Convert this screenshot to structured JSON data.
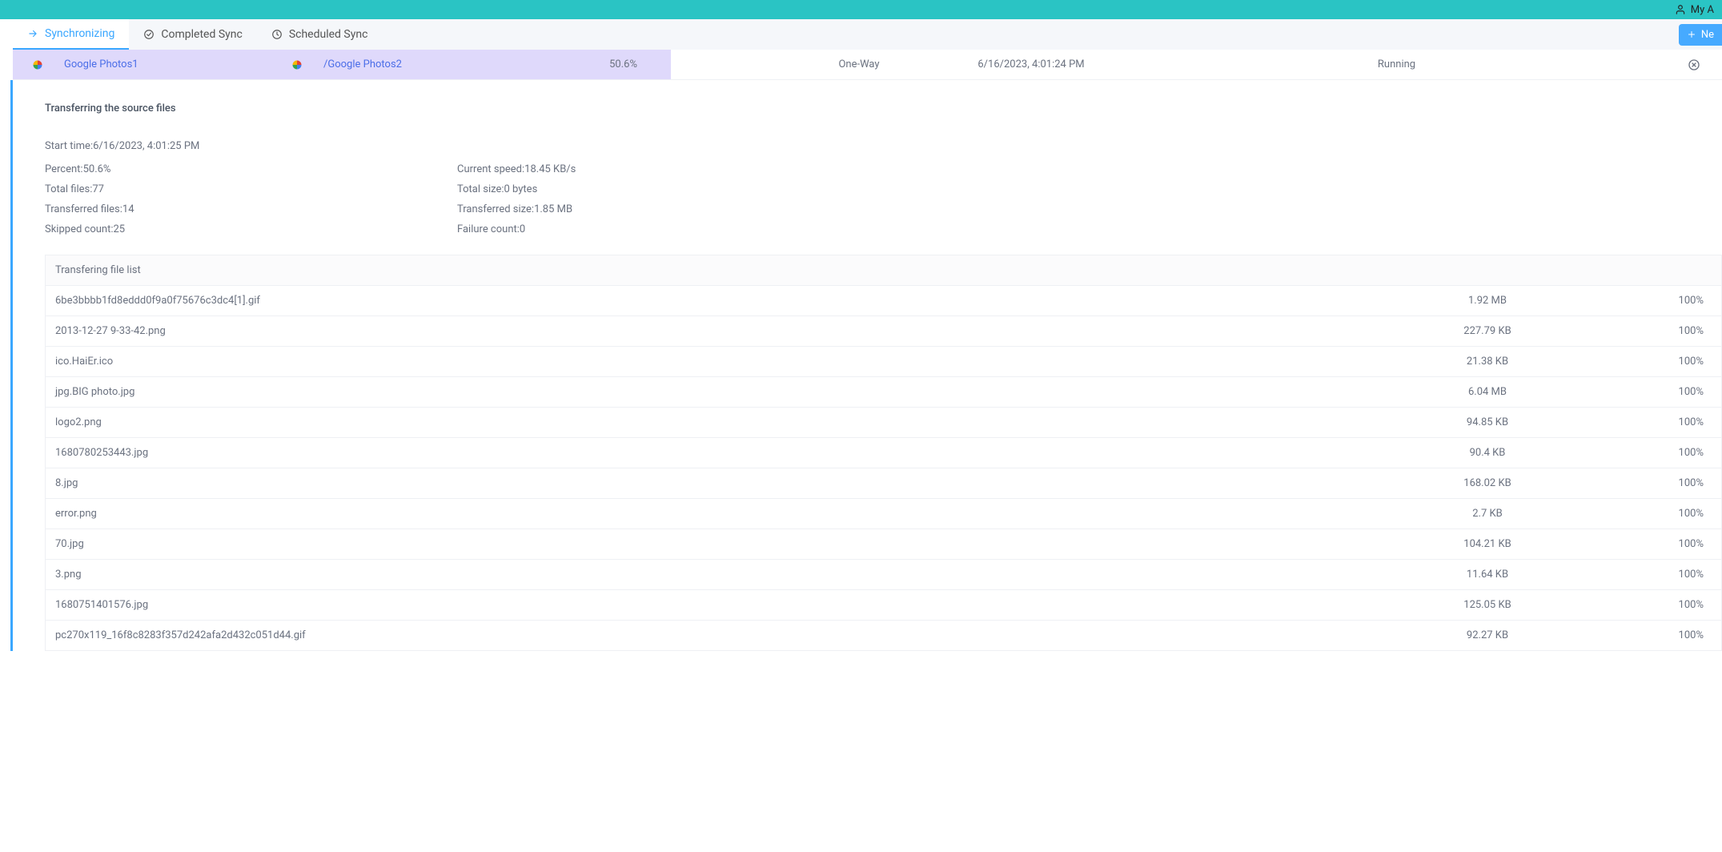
{
  "topbar": {
    "account_label": "My A"
  },
  "tabs": {
    "synchronizing": "Synchronizing",
    "completed": "Completed Sync",
    "scheduled": "Scheduled Sync",
    "new_button": "Ne"
  },
  "sync_job": {
    "source": "Google Photos1",
    "destination": "/Google Photos2",
    "percent": "50.6%",
    "mode": "One-Way",
    "time": "6/16/2023, 4:01:24 PM",
    "status": "Running"
  },
  "details": {
    "title": "Transferring the source files",
    "start_time_label": "Start time: ",
    "start_time": "6/16/2023, 4:01:25 PM",
    "left": {
      "percent_label": "Percent: ",
      "percent": "50.6%",
      "total_files_label": "Total files: ",
      "total_files": "77",
      "transferred_files_label": "Transferred files: ",
      "transferred_files": "14",
      "skipped_count_label": "Skipped count: ",
      "skipped_count": "25"
    },
    "right": {
      "current_speed_label": "Current speed: ",
      "current_speed": "18.45 KB/s",
      "total_size_label": "Total size: ",
      "total_size": "0 bytes",
      "transferred_size_label": "Transferred size: ",
      "transferred_size": "1.85 MB",
      "failure_count_label": "Failure count: ",
      "failure_count": "0"
    }
  },
  "file_list": {
    "header": "Transfering file list",
    "rows": [
      {
        "name": "6be3bbbb1fd8eddd0f9a0f75676c3dc4[1].gif",
        "size": "1.92 MB",
        "pct": "100%"
      },
      {
        "name": "2013-12-27 9-33-42.png",
        "size": "227.79 KB",
        "pct": "100%"
      },
      {
        "name": "ico.HaiEr.ico",
        "size": "21.38 KB",
        "pct": "100%"
      },
      {
        "name": "jpg.BIG photo.jpg",
        "size": "6.04 MB",
        "pct": "100%"
      },
      {
        "name": "logo2.png",
        "size": "94.85 KB",
        "pct": "100%"
      },
      {
        "name": "1680780253443.jpg",
        "size": "90.4 KB",
        "pct": "100%"
      },
      {
        "name": "8.jpg",
        "size": "168.02 KB",
        "pct": "100%"
      },
      {
        "name": "error.png",
        "size": "2.7 KB",
        "pct": "100%"
      },
      {
        "name": "70.jpg",
        "size": "104.21 KB",
        "pct": "100%"
      },
      {
        "name": "3.png",
        "size": "11.64 KB",
        "pct": "100%"
      },
      {
        "name": "1680751401576.jpg",
        "size": "125.05 KB",
        "pct": "100%"
      },
      {
        "name": "pc270x119_16f8c8283f357d242afa2d432c051d44.gif",
        "size": "92.27 KB",
        "pct": "100%"
      }
    ]
  }
}
